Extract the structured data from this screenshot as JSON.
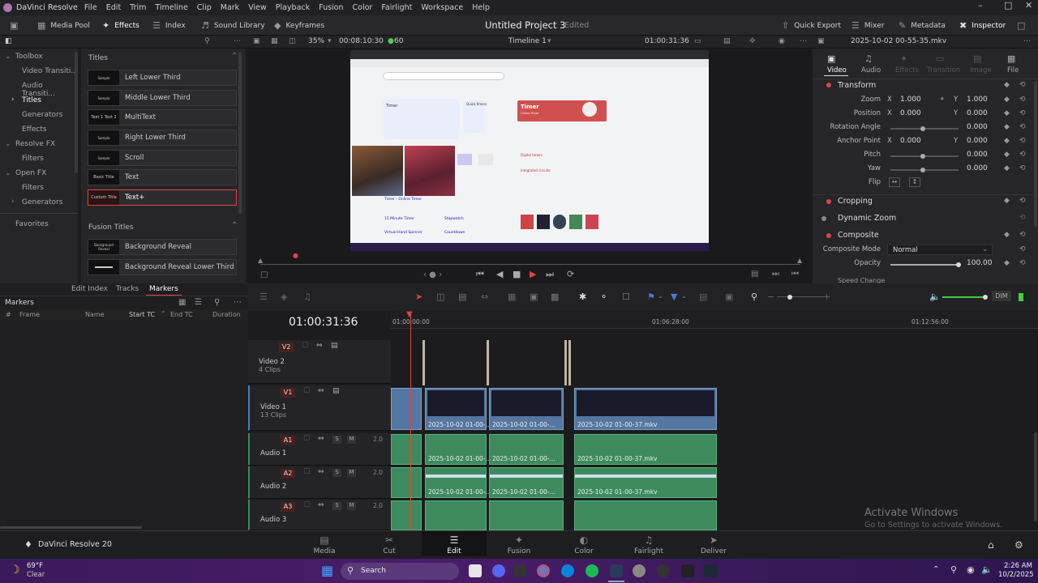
{
  "menubar": {
    "app_name": "DaVinci Resolve",
    "items": [
      "File",
      "Edit",
      "Trim",
      "Timeline",
      "Clip",
      "Mark",
      "View",
      "Playback",
      "Fusion",
      "Color",
      "Fairlight",
      "Workspace",
      "Help"
    ]
  },
  "toolbar": {
    "media_pool": "Media Pool",
    "effects": "Effects",
    "index": "Index",
    "sound_library": "Sound Library",
    "keyframes": "Keyframes",
    "project_title": "Untitled Project 3",
    "edited": "Edited",
    "quick_export": "Quick Export",
    "mixer": "Mixer",
    "metadata": "Metadata",
    "inspector": "Inspector"
  },
  "viewer_bar": {
    "zoom": "35%",
    "timecode_left": "00:08:10:30",
    "fps": "60",
    "timeline_name": "Timeline 1",
    "timecode_right": "01:00:31:36",
    "clip_name": "2025-10-02 00-55-35.mkv"
  },
  "left_nav": {
    "toolbox": "Toolbox",
    "video_transitions": "Video Transiti...",
    "audio_transitions": "Audio Transiti...",
    "titles": "Titles",
    "generators": "Generators",
    "effects": "Effects",
    "resolve_fx": "Resolve FX",
    "filters": "Filters",
    "open_fx": "Open FX",
    "filters2": "Filters",
    "generators2": "Generators",
    "favorites": "Favorites"
  },
  "effects_panel": {
    "titles_header": "Titles",
    "fusion_header": "Fusion Titles",
    "titles": [
      {
        "thumb": "Sample",
        "label": "Left Lower Third"
      },
      {
        "thumb": "Sample",
        "label": "Middle Lower Third"
      },
      {
        "thumb": "Text 1 Text 2",
        "label": "MultiText"
      },
      {
        "thumb": "Sample",
        "label": "Right Lower Third"
      },
      {
        "thumb": "Sample",
        "label": "Scroll"
      },
      {
        "thumb": "Basic Title",
        "label": "Text"
      },
      {
        "thumb": "Custom Title",
        "label": "Text+"
      }
    ],
    "fusion": [
      {
        "thumb": "Background Reveal",
        "label": "Background Reveal"
      },
      {
        "thumb": "",
        "label": "Background Reveal Lower Third"
      }
    ]
  },
  "preview": {
    "timer_title": "Timer",
    "timer_sub": "Online Timer",
    "quick_timers": "Quick timers",
    "digital_timers": "Digital timers",
    "integrated": "Integrated circuits",
    "link1": "Timer - Online Timer",
    "link2": "15 Minute Timer",
    "link3": "Stopwatch",
    "link4": "Virtual Hand Spinner",
    "link5": "Countdown"
  },
  "inspector": {
    "tabs": [
      "Video",
      "Audio",
      "Effects",
      "Transition",
      "Image",
      "File"
    ],
    "transform": "Transform",
    "zoom_label": "Zoom",
    "zoom_x": "1.000",
    "zoom_y": "1.000",
    "position_label": "Position",
    "pos_x": "0.000",
    "pos_y": "0.000",
    "rotation_label": "Rotation Angle",
    "rotation": "0.000",
    "anchor_label": "Anchor Point",
    "anchor_x": "0.000",
    "anchor_y": "0.000",
    "pitch_label": "Pitch",
    "pitch": "0.000",
    "yaw_label": "Yaw",
    "yaw": "0.000",
    "flip_label": "Flip",
    "x": "X",
    "y": "Y",
    "cropping": "Cropping",
    "dynamic_zoom": "Dynamic Zoom",
    "composite": "Composite",
    "composite_mode_label": "Composite Mode",
    "composite_mode": "Normal",
    "opacity_label": "Opacity",
    "opacity": "100.00",
    "speed_change": "Speed Change"
  },
  "markers_panel": {
    "tabs": [
      "Edit Index",
      "Tracks",
      "Markers"
    ],
    "title": "Markers",
    "columns": [
      "#",
      "Frame",
      "Name",
      "Start TC",
      "End TC",
      "Duration"
    ]
  },
  "timeline": {
    "timecode": "01:00:31:36",
    "ruler": [
      "01:00:00:00",
      "01:06:28:00",
      "01:12:56:00"
    ],
    "dim": "DIM",
    "tracks": [
      {
        "badge": "V2",
        "name": "Video 2",
        "sub": "4 Clips"
      },
      {
        "badge": "V1",
        "name": "Video 1",
        "sub": "13 Clips"
      },
      {
        "badge": "A1",
        "name": "Audio 1",
        "level": "2.0"
      },
      {
        "badge": "A2",
        "name": "Audio 2",
        "level": "2.0"
      },
      {
        "badge": "A3",
        "name": "Audio 3",
        "level": "2.0"
      }
    ],
    "clip_labels": {
      "c1": "2025-10-02 01-00-...",
      "c2": "2025-10-02 01-00-...",
      "c3": "2025-10-02 01-00-37.mkv"
    },
    "solo": "S",
    "mute": "M"
  },
  "pages": {
    "brand": "DaVinci Resolve 20",
    "items": [
      "Media",
      "Cut",
      "Edit",
      "Fusion",
      "Color",
      "Fairlight",
      "Deliver"
    ],
    "watermark1": "Activate Windows",
    "watermark2": "Go to Settings to activate Windows."
  },
  "taskbar": {
    "temp": "69°F",
    "weather": "Clear",
    "search": "Search",
    "time": "2:26 AM",
    "date": "10/2/2025"
  },
  "colors": {
    "accent_red": "#e04545",
    "video_clip": "#5576a0",
    "audio_clip": "#3d8a5e",
    "playhead": "#e04545"
  }
}
